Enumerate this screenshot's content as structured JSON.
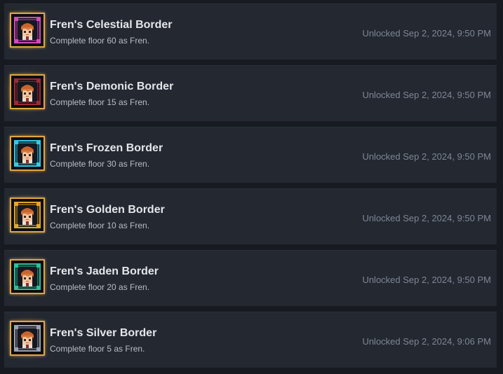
{
  "achievements": [
    {
      "title": "Fren's Celestial Border",
      "description": "Complete floor 60 as Fren.",
      "unlocked": "Unlocked Sep 2, 2024, 9:50 PM",
      "frame_color": "#d04bb8",
      "icon": "fren-celestial-border-icon"
    },
    {
      "title": "Fren's Demonic Border",
      "description": "Complete floor 15 as Fren.",
      "unlocked": "Unlocked Sep 2, 2024, 9:50 PM",
      "frame_color": "#9e2a3a",
      "icon": "fren-demonic-border-icon"
    },
    {
      "title": "Fren's Frozen Border",
      "description": "Complete floor 30 as Fren.",
      "unlocked": "Unlocked Sep 2, 2024, 9:50 PM",
      "frame_color": "#36c9e6",
      "icon": "fren-frozen-border-icon"
    },
    {
      "title": "Fren's Golden Border",
      "description": "Complete floor 10 as Fren.",
      "unlocked": "Unlocked Sep 2, 2024, 9:50 PM",
      "frame_color": "#e2a72a",
      "icon": "fren-golden-border-icon"
    },
    {
      "title": "Fren's Jaden Border",
      "description": "Complete floor 20 as Fren.",
      "unlocked": "Unlocked Sep 2, 2024, 9:50 PM",
      "frame_color": "#2fbf9a",
      "icon": "fren-jaden-border-icon"
    },
    {
      "title": "Fren's Silver Border",
      "description": "Complete floor 5 as Fren.",
      "unlocked": "Unlocked Sep 2, 2024, 9:06 PM",
      "frame_color": "#9aa3b5",
      "icon": "fren-silver-border-icon"
    }
  ],
  "colors": {
    "page_background": "#171a21",
    "row_background": "#232831",
    "title_text": "#e4e6ea",
    "description_text": "#b8bdc6",
    "timestamp_text": "#7f8794",
    "achievement_glow": "#e0a640"
  }
}
